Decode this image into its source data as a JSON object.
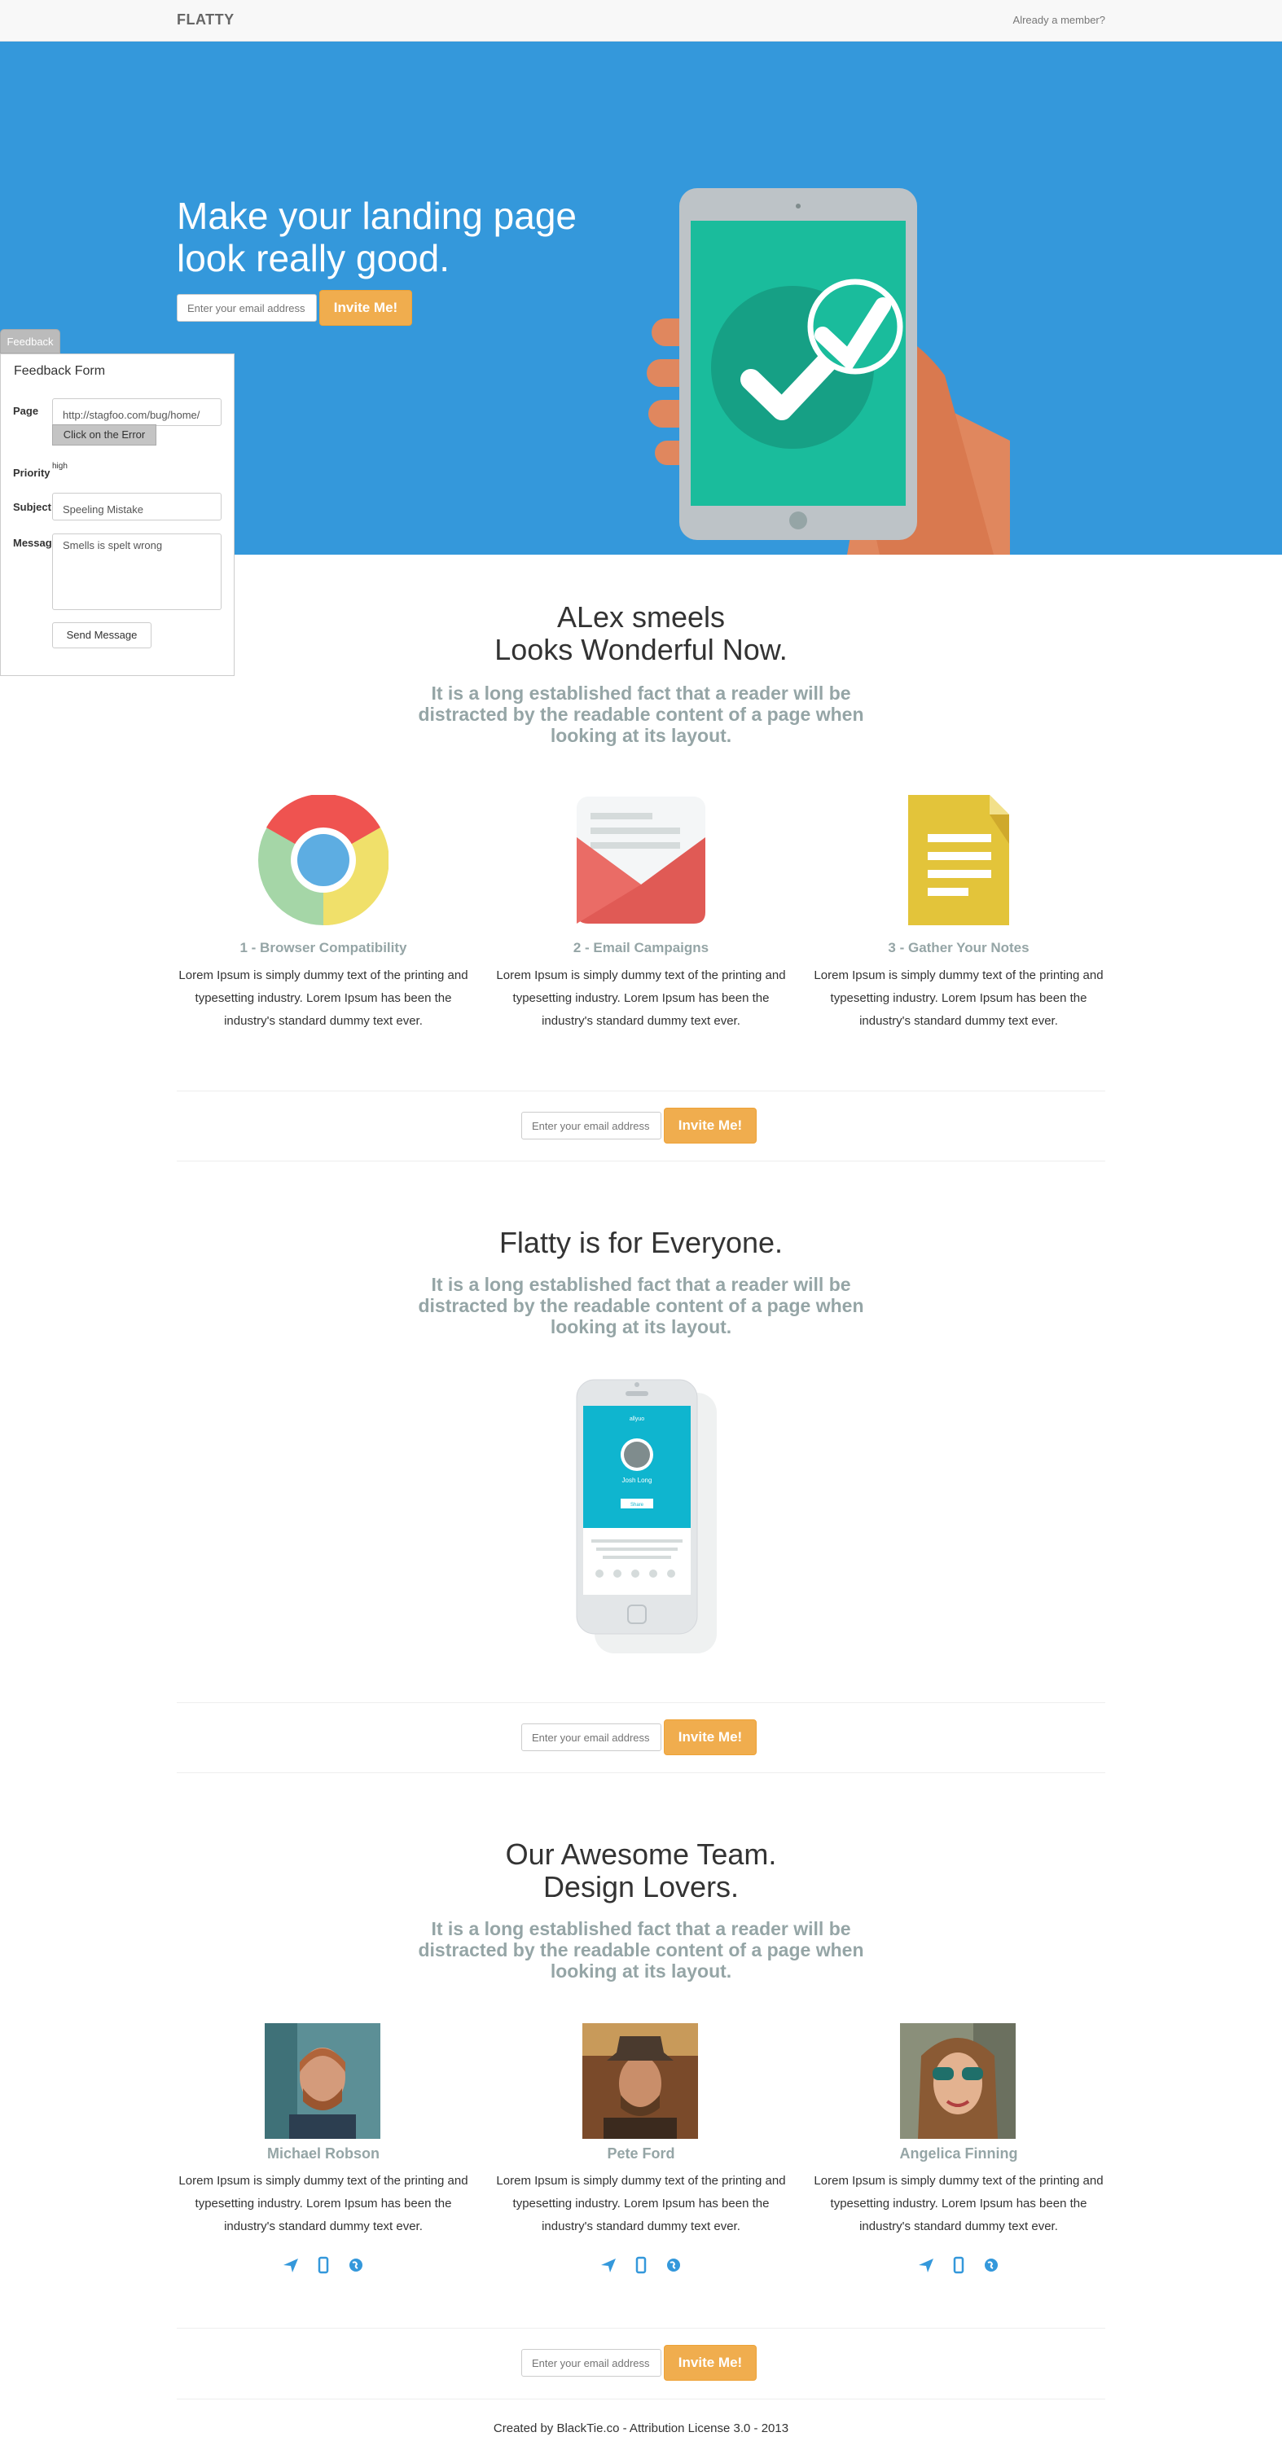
{
  "navbar": {
    "brand": "FLATTY",
    "member_link": "Already a member?"
  },
  "hero": {
    "title": "Make your landing page look really good.",
    "email_placeholder": "Enter your email address",
    "invite_label": "Invite Me!",
    "art_icon": "tablet-checkmark-hand-illustration"
  },
  "feedback": {
    "tab_label": "Feedback",
    "title": "Feedback Form",
    "page_label": "Page",
    "page_value": "http://stagfoo.com/bug/home/",
    "error_button": "Click on the Error",
    "priority_label": "Priority",
    "priority_value": "high",
    "subject_label": "Subject",
    "subject_value": "Speeling Mistake",
    "message_label": "Message",
    "message_value": "Smells is spelt wrong",
    "send_label": "Send Message"
  },
  "intro": {
    "title_line1": "ALex smeels",
    "title_line2": "Looks Wonderful Now.",
    "subtitle": "It is a long established fact that a reader will be distracted by the readable content of a page when looking at its layout."
  },
  "features": [
    {
      "icon": "chrome-browser-icon",
      "title": "1 - Browser Compatibility",
      "text": "Lorem Ipsum is simply dummy text of the printing and typesetting industry. Lorem Ipsum has been the industry's standard dummy text ever."
    },
    {
      "icon": "envelope-icon",
      "title": "2 - Email Campaigns",
      "text": "Lorem Ipsum is simply dummy text of the printing and typesetting industry. Lorem Ipsum has been the industry's standard dummy text ever."
    },
    {
      "icon": "notes-document-icon",
      "title": "3 - Gather Your Notes",
      "text": "Lorem Ipsum is simply dummy text of the printing and typesetting industry. Lorem Ipsum has been the industry's standard dummy text ever."
    }
  ],
  "cta": {
    "email_placeholder": "Enter your email address",
    "invite_label": "Invite Me!"
  },
  "everyone": {
    "title": "Flatty is for Everyone.",
    "subtitle": "It is a long established fact that a reader will be distracted by the readable content of a page when looking at its layout.",
    "phone_app_name": "allyuo",
    "phone_user": "Josh Long",
    "phone_button": "Share"
  },
  "team": {
    "title_line1": "Our Awesome Team.",
    "title_line2": "Design Lovers.",
    "subtitle": "It is a long established fact that a reader will be distracted by the readable content of a page when looking at its layout.",
    "members": [
      {
        "name": "Michael Robson",
        "text": "Lorem Ipsum is simply dummy text of the printing and typesetting industry. Lorem Ipsum has been the industry's standard dummy text ever."
      },
      {
        "name": "Pete Ford",
        "text": "Lorem Ipsum is simply dummy text of the printing and typesetting industry. Lorem Ipsum has been the industry's standard dummy text ever."
      },
      {
        "name": "Angelica Finning",
        "text": "Lorem Ipsum is simply dummy text of the printing and typesetting industry. Lorem Ipsum has been the industry's standard dummy text ever."
      }
    ]
  },
  "footer": {
    "text": "Created by BlackTie.co - Attribution License 3.0 - 2013"
  },
  "colors": {
    "hero_blue": "#3498db",
    "accent_orange": "#f0ad4e",
    "muted_gray": "#95a5a6"
  }
}
